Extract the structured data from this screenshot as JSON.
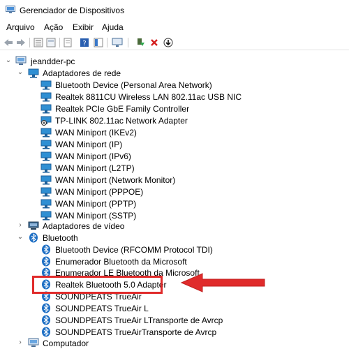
{
  "window": {
    "title": "Gerenciador de Dispositivos"
  },
  "menu": [
    "Arquivo",
    "Ação",
    "Exibir",
    "Ajuda"
  ],
  "colors": {
    "highlight": "#e02b2b",
    "network_icon": "#2f8fd3",
    "bluetooth_icon": "#1e6fc4"
  },
  "tree": {
    "root": "jeandder-pc",
    "groups": [
      {
        "label": "Adaptadores de rede",
        "expanded": true,
        "icon": "network-icon",
        "items": [
          "Bluetooth Device (Personal Area Network)",
          "Realtek 8811CU Wireless LAN 802.11ac USB NIC",
          "Realtek PCIe GbE Family Controller",
          "TP-LINK 802.11ac Network Adapter",
          "WAN Miniport (IKEv2)",
          "WAN Miniport (IP)",
          "WAN Miniport (IPv6)",
          "WAN Miniport (L2TP)",
          "WAN Miniport (Network Monitor)",
          "WAN Miniport (PPPOE)",
          "WAN Miniport (PPTP)",
          "WAN Miniport (SSTP)"
        ]
      },
      {
        "label": "Adaptadores de vídeo",
        "expanded": false,
        "icon": "display-icon"
      },
      {
        "label": "Bluetooth",
        "expanded": true,
        "icon": "bluetooth-icon",
        "items": [
          "Bluetooth Device (RFCOMM Protocol TDI)",
          "Enumerador Bluetooth da Microsoft",
          "Enumerador LE Bluetooth da Microsoft",
          "Realtek Bluetooth 5.0 Adapter",
          "SOUNDPEATS TrueAir",
          "SOUNDPEATS TrueAir L",
          "SOUNDPEATS TrueAir LTransporte de Avrcp",
          "SOUNDPEATS TrueAirTransporte de Avrcp"
        ]
      },
      {
        "label": "Computador",
        "expanded": false,
        "icon": "computer-icon"
      }
    ]
  }
}
